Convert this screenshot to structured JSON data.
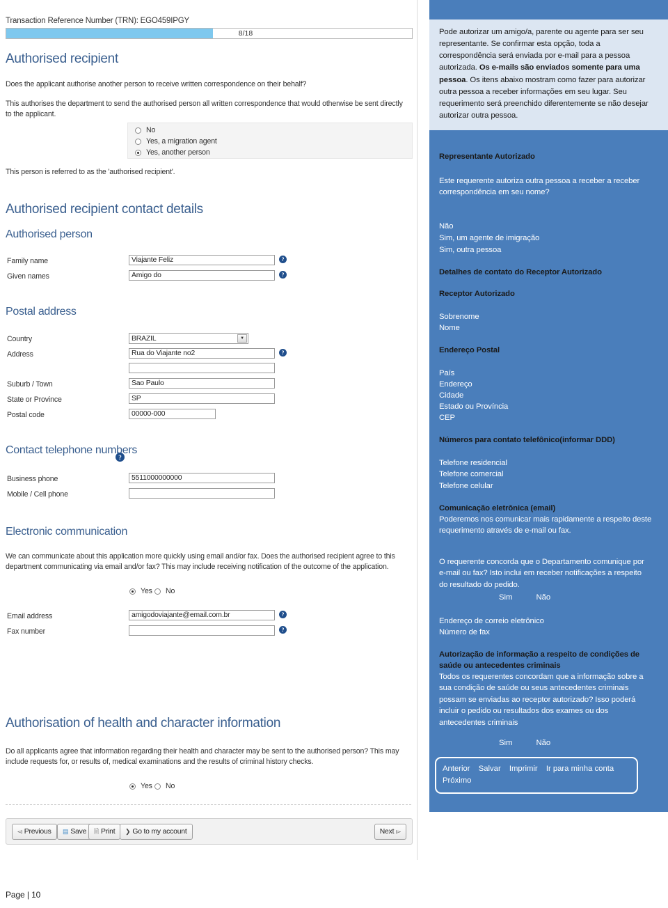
{
  "form": {
    "trn_label": "Transaction Reference Number (TRN): EGO459IPGY",
    "progress_value": "8/18",
    "section_authorised_recipient": "Authorised recipient",
    "question_1": "Does the applicant authorise another person to receive written correspondence on their behalf?",
    "note_1": "This authorises the department to send the authorised person all written correspondence that would otherwise be sent directly to the applicant.",
    "radio_options": [
      {
        "label": "No",
        "selected": false
      },
      {
        "label": "Yes, a migration agent",
        "selected": false
      },
      {
        "label": "Yes, another person",
        "selected": true
      }
    ],
    "note_2": "This person is referred to as the 'authorised recipient'.",
    "section_contact_details": "Authorised recipient contact details",
    "section_authorised_person": "Authorised person",
    "family_name_label": "Family name",
    "family_name_value": "Viajante Feliz",
    "given_names_label": "Given names",
    "given_names_value": "Amigo do",
    "section_postal_address": "Postal address",
    "country_label": "Country",
    "country_value": "BRAZIL",
    "address_label": "Address",
    "address_value": "Rua do Viajante no2",
    "address_line2_value": "",
    "suburb_label": "Suburb / Town",
    "suburb_value": "Sao Paulo",
    "state_label": "State or Province",
    "state_value": "SP",
    "postcode_label": "Postal code",
    "postcode_value": "00000-000",
    "section_phones": "Contact telephone numbers",
    "business_phone_label": "Business phone",
    "business_phone_value": "5511000000000",
    "mobile_label": "Mobile / Cell phone",
    "mobile_value": "",
    "section_electronic": "Electronic communication",
    "note_3": "We can communicate about this application more quickly using email and/or fax. Does the authorised recipient agree to this department communicating via email and/or fax? This may include receiving notification of the outcome of the application.",
    "yes_label": "Yes",
    "no_label": "No",
    "email_label": "Email address",
    "email_value": "amigodoviajante@email.com.br",
    "fax_label": "Fax number",
    "fax_value": "",
    "section_health": "Authorisation of health and character information",
    "note_4": "Do all applicants agree that information regarding their health and character may be sent to the authorised person? This may include requests for, or results of, medical examinations and the results of criminal history checks.",
    "yes_label_2": "Yes",
    "no_label_2": "No",
    "buttons": {
      "previous": "Previous",
      "save": "Save",
      "print": "Print",
      "account": "Go to my account",
      "next": "Next"
    }
  },
  "translation": {
    "callout_part1": "Pode autorizar um amigo/a, parente ou agente para ser seu representante. Se confirmar esta opção, toda a correspondência será enviada por e-mail para a pessoa autorizada. ",
    "callout_bold": "Os e-mails são enviados somente para uma pessoa",
    "callout_part2": ". Os itens abaixo mostram como fazer para autorizar outra pessoa a receber informações em seu lugar. Seu requerimento será preenchido diferentemente se não desejar autorizar outra pessoa.",
    "h_representante": "Representante Autorizado",
    "t_pergunta": "Este requerente autoriza outra pessoa a receber a receber correspondência em seu nome?",
    "opt_nao": "Não",
    "opt_sim_agente": "Sim, um agente de imigração",
    "opt_sim_outra": "Sim, outra pessoa",
    "h_detalhes": "Detalhes de contato do Receptor Autorizado",
    "h_receptor": "Receptor Autorizado",
    "t_sobrenome": "Sobrenome",
    "t_nome": "Nome",
    "h_endereco_postal": "Endereço Postal",
    "t_pais": "País",
    "t_endereco": "Endereço",
    "t_cidade": "Cidade",
    "t_estado": "Estado ou Província",
    "t_cep": "CEP",
    "h_telefones": "Números para contato telefônico(informar DDD)",
    "t_tel_res": "Telefone residencial",
    "t_tel_com": "Telefone comercial",
    "t_tel_cel": "Telefone celular",
    "h_comunicacao": "Comunicação eletrônica (email)",
    "t_comunicacao": "Poderemos nos comunicar mais  rapidamente a respeito deste requerimento através de e-mail ou fax.",
    "t_concorda": "O requerente concorda que o Departamento comunique por e-mail ou fax? Isto inclui em receber notificações a respeito do resultado do pedido.",
    "yn_sim_1": "Sim",
    "yn_nao_1": "Não",
    "t_email": "Endereço de correio eletrônico",
    "t_fax": "Número de fax",
    "h_autorizacao": "Autorização de informação a respeito de condições de saúde ou antecedentes criminais",
    "t_autorizacao": "Todos os requerentes concordam que a informação sobre a sua condição de saúde ou  seus antecedentes criminais  possam se enviadas ao receptor autorizado? Isso poderá incluir o pedido ou resultados  dos exames ou dos antecedentes criminais",
    "yn_sim_2": "Sim",
    "yn_nao_2": "Não",
    "btn_anterior": "Anterior",
    "btn_salvar": "Salvar",
    "btn_imprimir": "Imprimir",
    "btn_conta": "Ir para minha conta",
    "btn_proximo": "Próximo"
  },
  "footer": {
    "page_label": "Page | 10"
  },
  "colors": {
    "panel_blue": "#4a7ebb",
    "callout_blue": "#dce6f2",
    "heading_blue": "#3a5f8f",
    "progress_blue": "#7ec8ee",
    "help_icon_blue": "#1f4e8c"
  }
}
